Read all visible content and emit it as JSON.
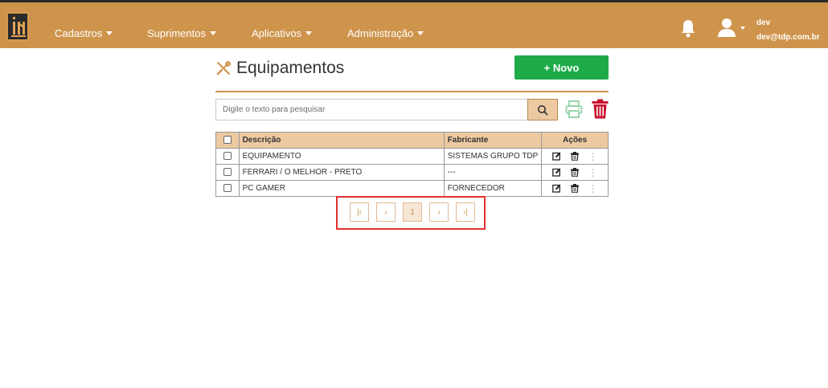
{
  "nav": {
    "items": [
      {
        "label": "Cadastros"
      },
      {
        "label": "Suprimentos"
      },
      {
        "label": "Aplicativos"
      },
      {
        "label": "Administração"
      }
    ]
  },
  "user": {
    "name": "dev",
    "email": "dev@tdp.com.br"
  },
  "page": {
    "title": "Equipamentos",
    "new_button": "+ Novo"
  },
  "search": {
    "placeholder": "Digite o texto para pesquisar",
    "value": ""
  },
  "table": {
    "headers": {
      "description": "Descrição",
      "manufacturer": "Fabricante",
      "actions": "Ações"
    },
    "rows": [
      {
        "description": "EQUIPAMENTO",
        "manufacturer": "SISTEMAS GRUPO TDP"
      },
      {
        "description": "FERRARI / O MELHOR - PRETO",
        "manufacturer": "---"
      },
      {
        "description": "PC GAMER",
        "manufacturer": "FORNECEDOR"
      }
    ]
  },
  "pagination": {
    "first": "|‹",
    "prev": "‹",
    "current": "1",
    "next": "›",
    "last": "›|"
  },
  "colors": {
    "brand": "#cf944c",
    "new_button": "#1faa4a",
    "delete": "#c8102e",
    "print": "#8fd1a4",
    "pager_frame": "#e03030"
  },
  "icons": [
    "bell-icon",
    "user-icon",
    "tools-icon",
    "search-icon",
    "print-icon",
    "trash-icon",
    "edit-icon",
    "more-vertical-icon"
  ]
}
